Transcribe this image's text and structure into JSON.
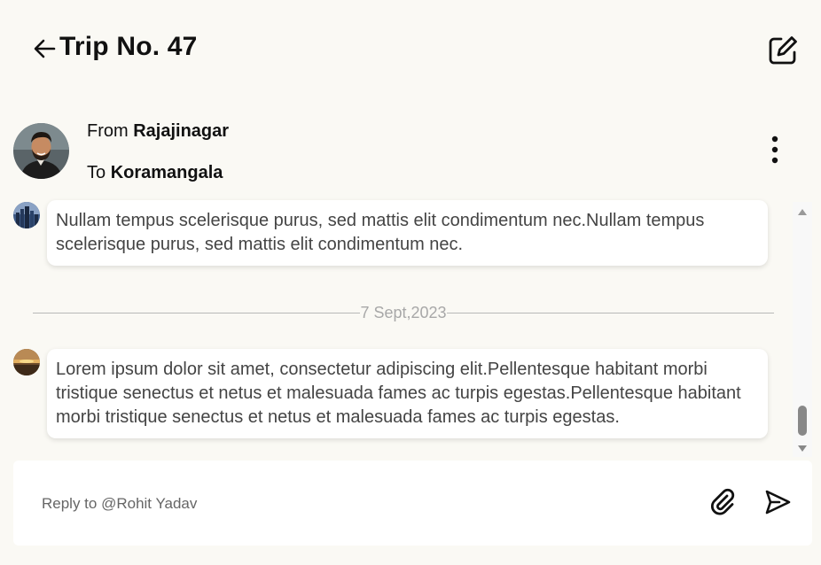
{
  "header": {
    "title": "Trip No. 47",
    "back_icon": "arrow-left-icon",
    "edit_icon": "edit-square-icon"
  },
  "trip": {
    "from_prefix": "From",
    "from_place": "Rajajinagar",
    "to_prefix": "To",
    "to_place": "Koramangala",
    "more_icon": "more-vertical-icon"
  },
  "messages": [
    {
      "avatar": "city-avatar",
      "text": "Nullam tempus scelerisque purus, sed mattis elit condimentum nec.Nullam tempus scelerisque purus, sed mattis elit condimentum nec."
    },
    {
      "avatar": "sunset-avatar",
      "text": "Lorem ipsum dolor sit amet, consectetur adipiscing elit.Pellentesque habitant morbi tristique senectus et netus et malesuada fames ac turpis egestas.Pellentesque habitant morbi tristique senectus et netus et malesuada fames ac turpis egestas."
    }
  ],
  "date_divider": "7 Sept,2023",
  "reply": {
    "placeholder": "Reply to @Rohit Yadav",
    "attach_icon": "paperclip-icon",
    "send_icon": "send-icon"
  },
  "colors": {
    "background": "#faf9f4",
    "card": "#ffffff",
    "text": "#111111",
    "message_text": "#444444",
    "divider": "#b8b8b8"
  }
}
